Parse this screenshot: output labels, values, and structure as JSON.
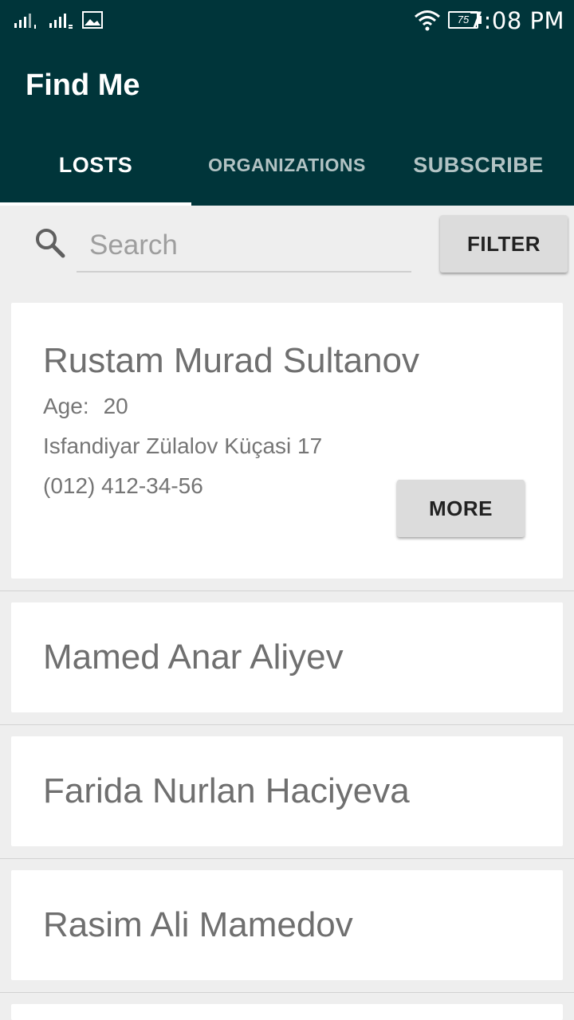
{
  "status_bar": {
    "time": "7:08 PM",
    "battery": "75",
    "icons": [
      "signal-sim1-icon",
      "signal-sim2-icon",
      "image-notification-icon",
      "wifi-icon",
      "battery-icon"
    ]
  },
  "app": {
    "title": "Find Me",
    "primary_color": "#00353a"
  },
  "tabs": [
    {
      "label": "LOSTS",
      "active": true
    },
    {
      "label": "ORGANIZATIONS",
      "active": false
    },
    {
      "label": "SUBSCRIBE",
      "active": false
    }
  ],
  "search": {
    "placeholder": "Search",
    "value": "",
    "icon": "search-icon",
    "filter_label": "FILTER"
  },
  "people": [
    {
      "name": "Rustam Murad Sultanov",
      "age_label": "Age:",
      "age": "20",
      "address": "Isfandiyar Zülalov Küçasi 17",
      "phone": "(012) 412-34-56",
      "more_label": "MORE",
      "expanded": true
    },
    {
      "name": "Mamed Anar Aliyev",
      "expanded": false
    },
    {
      "name": "Farida Nurlan Haciyeva",
      "expanded": false
    },
    {
      "name": "Rasim Ali Mamedov",
      "expanded": false
    }
  ]
}
